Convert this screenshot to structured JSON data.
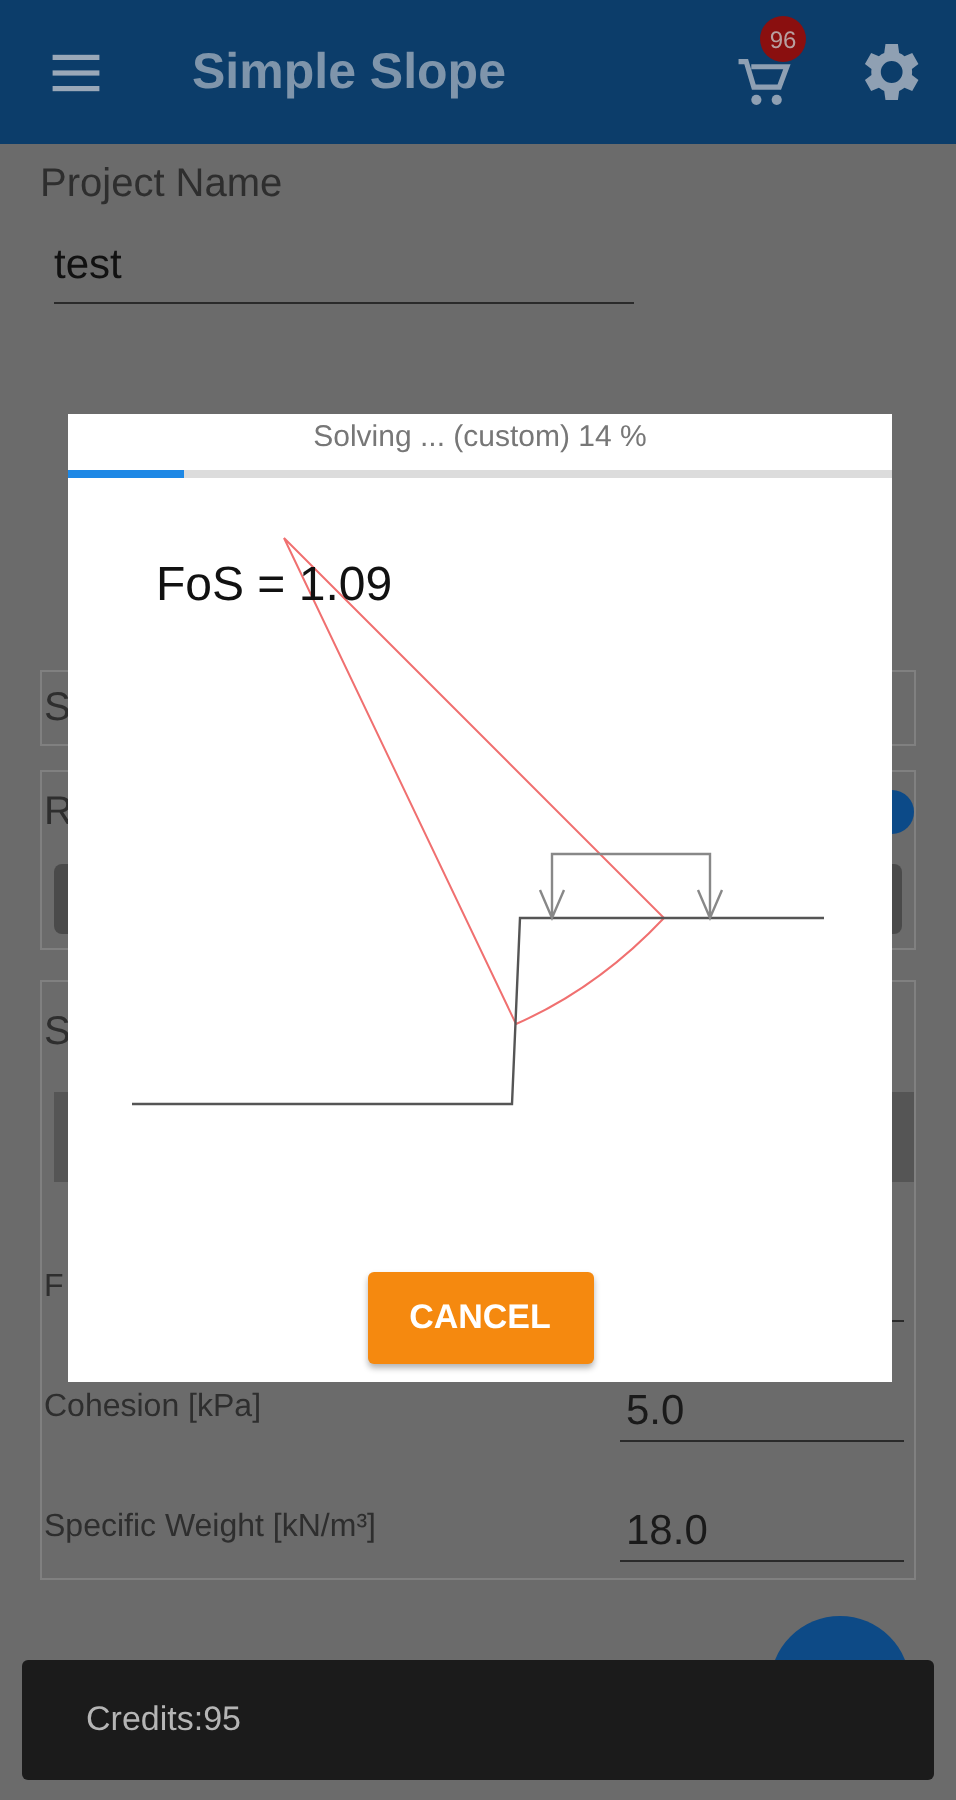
{
  "app_bar": {
    "title": "Simple Slope",
    "cart_badge": "96"
  },
  "form": {
    "project_label": "Project Name",
    "project_value": "test",
    "cards": [
      {
        "kind": "field",
        "label": "S"
      },
      {
        "kind": "toggle",
        "label": "R",
        "on": true
      },
      {
        "kind": "params",
        "label": "S",
        "params": [
          {
            "label": "F"
          },
          {
            "label": "Cohesion [kPa]",
            "value": "5.0"
          },
          {
            "label": "Specific Weight [kN/m³]",
            "value": "18.0"
          }
        ]
      }
    ]
  },
  "dialog": {
    "progress_text": "Solving ... (custom) 14 %",
    "level": 0.14,
    "result": "FoS = 1.09",
    "button": "CANCEL"
  },
  "snackbar": {
    "text": "Credits:95"
  }
}
